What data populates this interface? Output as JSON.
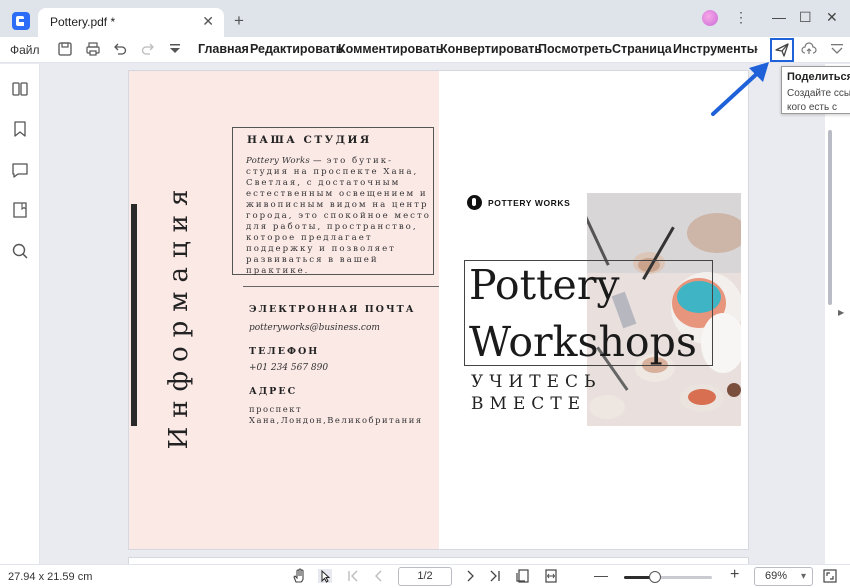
{
  "tab": {
    "title": "Pottery.pdf *"
  },
  "menubar": {
    "file_label": "Файл",
    "items": [
      "Главная",
      "Редактировать",
      "Комментировать",
      "Конвертировать",
      "Посмотреть",
      "Страница",
      "Инструменты"
    ]
  },
  "tooltip": {
    "title": "Поделиться",
    "body": "Создайте ссы у кого есть с"
  },
  "document": {
    "vertical_title": "Информация",
    "studio_heading": "НАША СТУДИЯ",
    "studio_lead": "Pottery Works —",
    "studio_text": " это бутик-студия на проспекте Хана, Светлая, с достаточным естественным освещением и живописным видом на центр города, это спокойное место для работы, пространство, которое предлагает поддержку и позволяет развиваться в вашей практике.",
    "email_heading": "ЭЛЕКТРОННАЯ ПОЧТА",
    "email": "potteryworks@business.com",
    "phone_heading": "ТЕЛЕФОН",
    "phone": "+01 234 567 890",
    "address_heading": "АДРЕС",
    "address": "проспект Хана,Лондон,Великобритания",
    "brand": "POTTERY WORKS",
    "hero_line1": "Pottery",
    "hero_line2": "Workshops",
    "tagline_line1": "УЧИТЕСЬ",
    "tagline_line2": "ВМЕСТЕ"
  },
  "statusbar": {
    "page_size": "27.94 x 21.59 cm",
    "page_indicator": "1/2",
    "zoom": "69%",
    "zoom_fraction": 0.35
  },
  "colors": {
    "accent": "#1f61d8",
    "left_panel": "#fbe9e6"
  }
}
